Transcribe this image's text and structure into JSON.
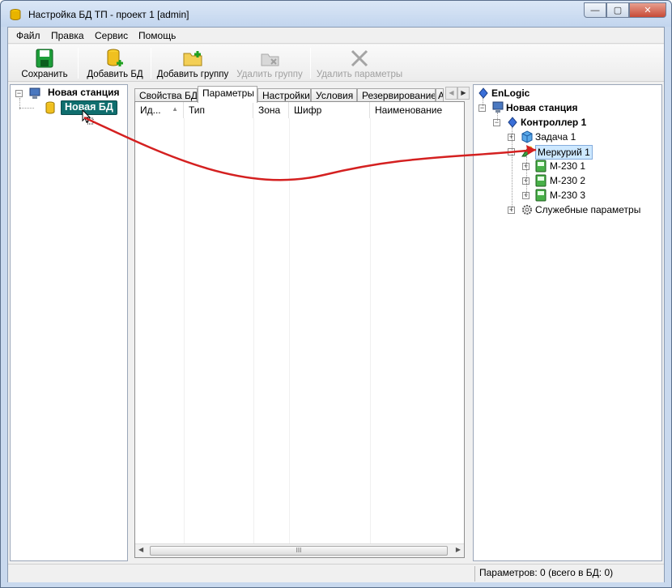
{
  "window": {
    "title": "Настройка БД ТП - проект 1 [admin]",
    "min_label": "—",
    "max_label": "▢",
    "close_label": "✕"
  },
  "menu": [
    "Файл",
    "Правка",
    "Сервис",
    "Помощь"
  ],
  "toolbar": {
    "save": "Сохранить",
    "add_db": "Добавить БД",
    "add_group": "Добавить группу",
    "delete_group": "Удалить группу",
    "delete_params": "Удалить параметры"
  },
  "left_tree": {
    "station": "Новая станция",
    "db": "Новая БД"
  },
  "tabs": [
    "Свойства БД",
    "Параметры",
    "Настройки",
    "Условия",
    "Резервирование",
    "А"
  ],
  "grid": {
    "columns": [
      "Ид...",
      "Тип",
      "Зона",
      "Шифр",
      "Наименование"
    ],
    "scroll_grip": "III"
  },
  "right_tree": {
    "root": "EnLogic",
    "station": "Новая станция",
    "controller": "Контроллер 1",
    "task": "Задача 1",
    "mercury": "Меркурий 1",
    "devices": [
      "М-230 1",
      "М-230 2",
      "М-230 3"
    ],
    "service": "Служебные параметры"
  },
  "status": {
    "params": "Параметров: 0 (всего в БД: 0)"
  },
  "colors": {
    "selection": "#cde8ff",
    "drag_label": "#0f6e6e",
    "arrow": "#d42020"
  }
}
